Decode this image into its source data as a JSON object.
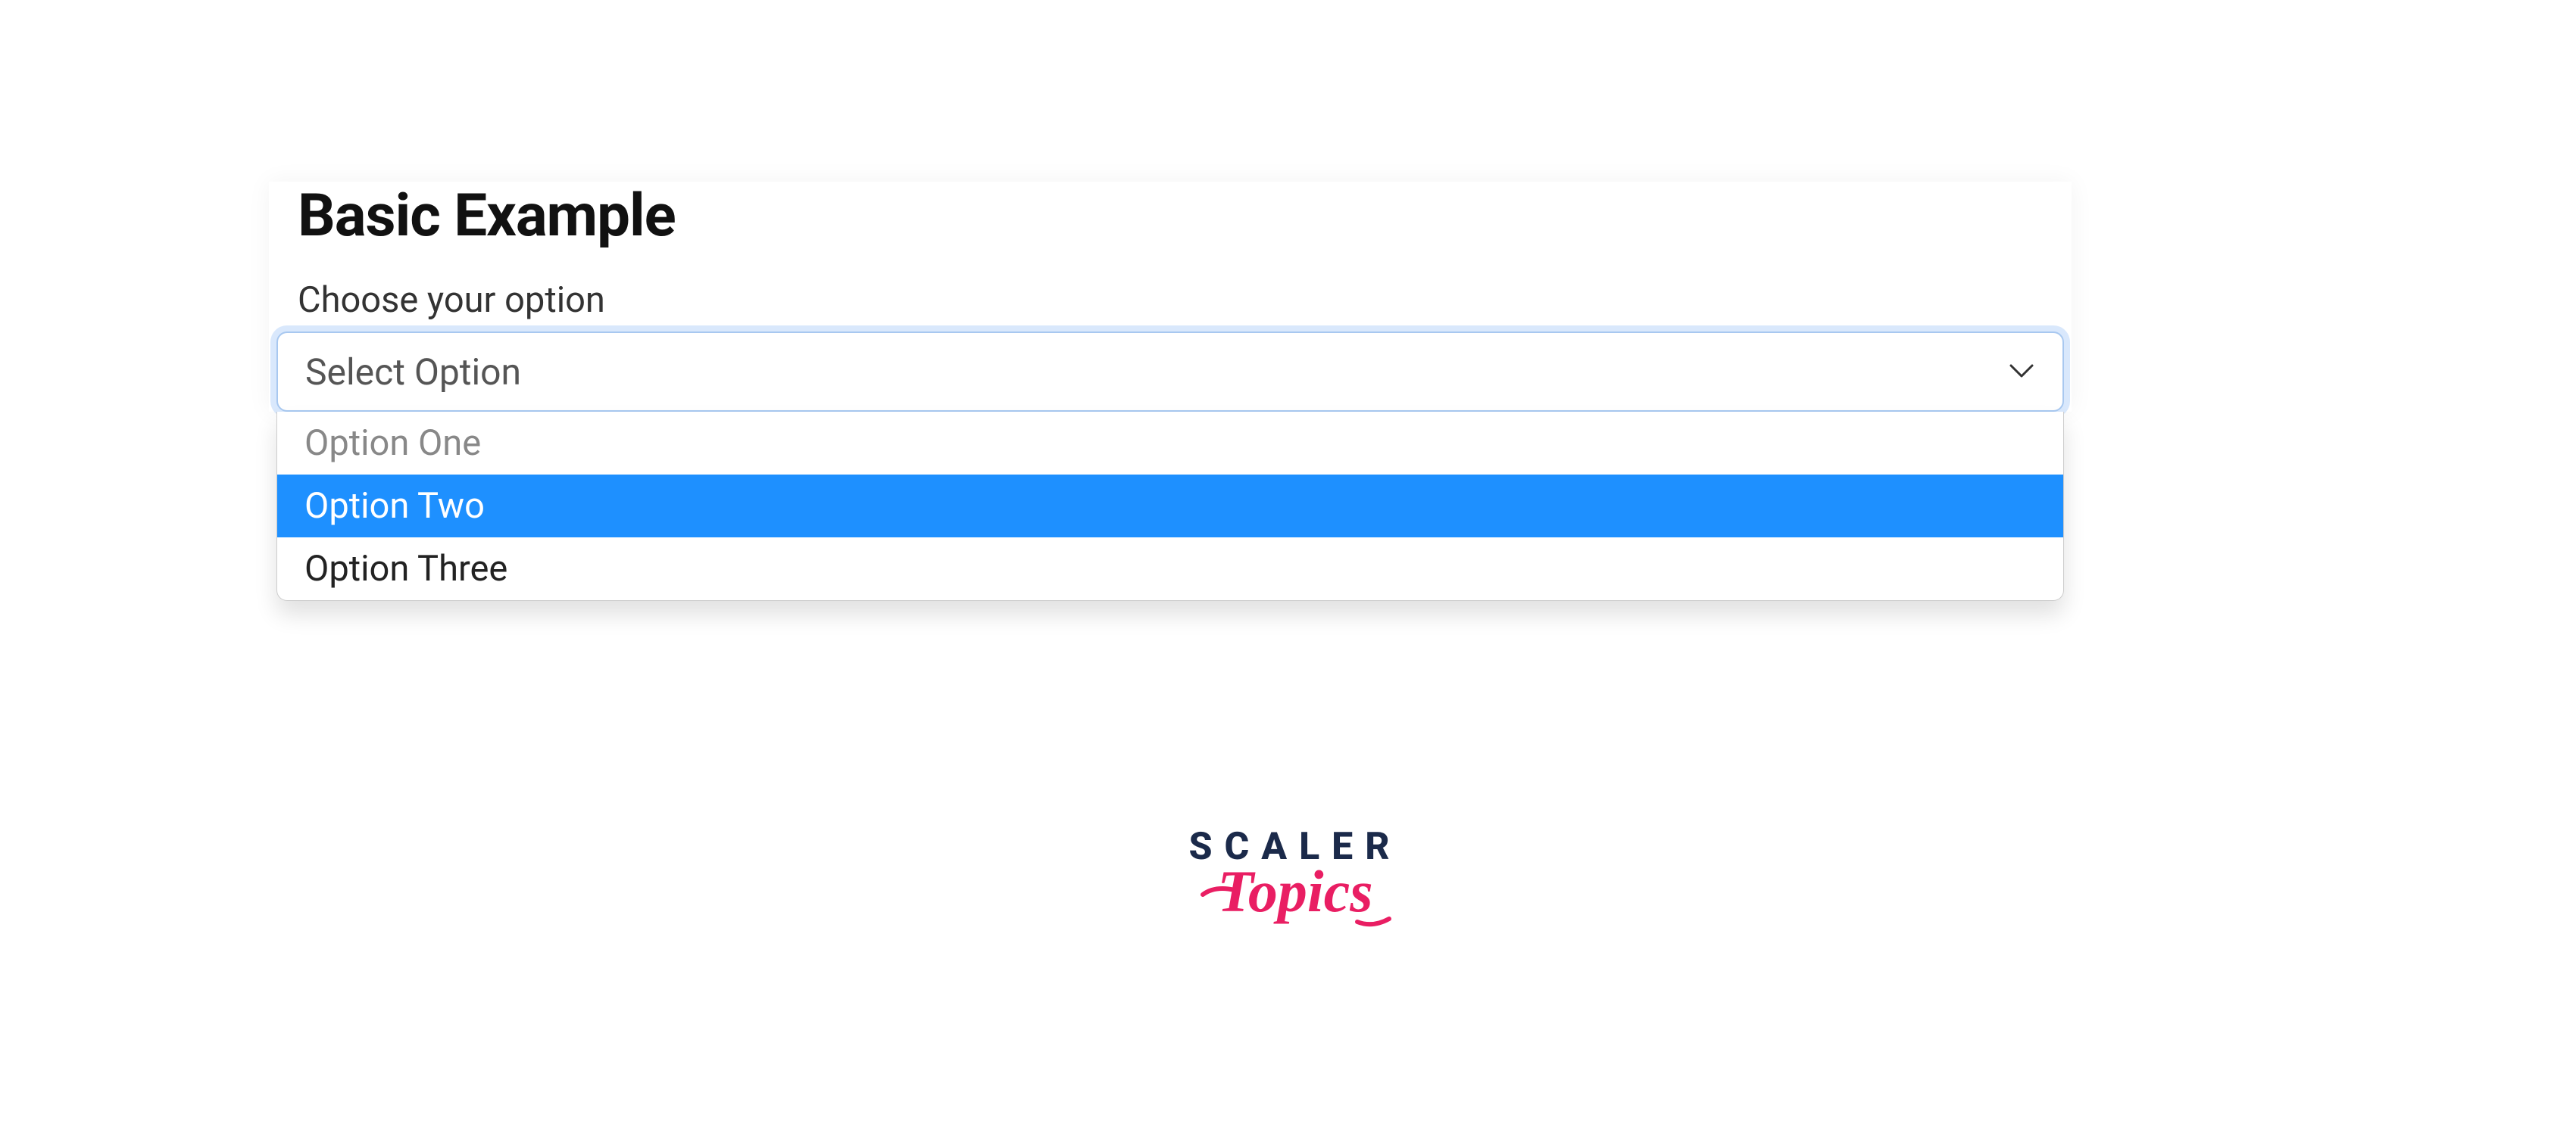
{
  "title": "Basic Example",
  "label": "Choose your option",
  "select": {
    "placeholder": "Select Option",
    "options": [
      {
        "label": "Option One",
        "state": "dimmed"
      },
      {
        "label": "Option Two",
        "state": "highlighted"
      },
      {
        "label": "Option Three",
        "state": "normal"
      }
    ]
  },
  "branding": {
    "line1": "SCALER",
    "line2": "Topics"
  },
  "colors": {
    "focus_ring": "#b4d2fa",
    "focus_border": "#a8c8f0",
    "highlight": "#1e90ff",
    "brand_dark": "#1b2a4a",
    "brand_pink": "#e91e63"
  }
}
